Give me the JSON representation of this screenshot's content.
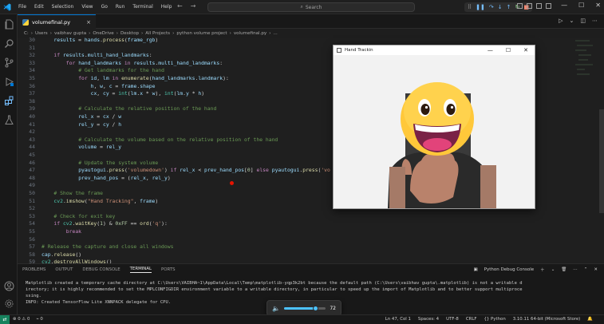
{
  "titlebar": {
    "menu": [
      "File",
      "Edit",
      "Selection",
      "View",
      "Go",
      "Run",
      "Terminal",
      "Help"
    ],
    "search_label": "Search"
  },
  "tab": {
    "filename": "volumefinal.py",
    "close_glyph": "×"
  },
  "breadcrumb": [
    "C:",
    "Users",
    "vaibhav gupta",
    "OneDrive",
    "Desktop",
    "All Projects",
    "python volume project",
    "volumefinal.py",
    "..."
  ],
  "code_lines": [
    {
      "n": "30",
      "indent": 2,
      "segs": [
        [
          "var",
          "results"
        ],
        [
          "op",
          " = "
        ],
        [
          "var",
          "hands"
        ],
        [
          "op",
          "."
        ],
        [
          "fn",
          "process"
        ],
        [
          "op",
          "("
        ],
        [
          "var",
          "frame_rgb"
        ],
        [
          "op",
          ")"
        ]
      ]
    },
    {
      "n": "31",
      "indent": 0,
      "segs": []
    },
    {
      "n": "32",
      "indent": 2,
      "segs": [
        [
          "kw",
          "if "
        ],
        [
          "var",
          "results"
        ],
        [
          "op",
          "."
        ],
        [
          "var",
          "multi_hand_landmarks"
        ],
        [
          "op",
          ":"
        ]
      ]
    },
    {
      "n": "33",
      "indent": 4,
      "segs": [
        [
          "kw",
          "for "
        ],
        [
          "var",
          "hand_landmarks"
        ],
        [
          "kw",
          " in "
        ],
        [
          "var",
          "results"
        ],
        [
          "op",
          "."
        ],
        [
          "var",
          "multi_hand_landmarks"
        ],
        [
          "op",
          ":"
        ]
      ]
    },
    {
      "n": "34",
      "indent": 6,
      "segs": [
        [
          "cm",
          "# Get landmarks for the hand"
        ]
      ]
    },
    {
      "n": "35",
      "indent": 6,
      "segs": [
        [
          "kw",
          "for "
        ],
        [
          "var",
          "id"
        ],
        [
          "op",
          ", "
        ],
        [
          "var",
          "lm"
        ],
        [
          "kw",
          " in "
        ],
        [
          "fn",
          "enumerate"
        ],
        [
          "op",
          "("
        ],
        [
          "var",
          "hand_landmarks"
        ],
        [
          "op",
          "."
        ],
        [
          "var",
          "landmark"
        ],
        [
          "op",
          "):"
        ]
      ]
    },
    {
      "n": "36",
      "indent": 8,
      "segs": [
        [
          "var",
          "h"
        ],
        [
          "op",
          ", "
        ],
        [
          "var",
          "w"
        ],
        [
          "op",
          ", "
        ],
        [
          "var",
          "c"
        ],
        [
          "op",
          " = "
        ],
        [
          "var",
          "frame"
        ],
        [
          "op",
          "."
        ],
        [
          "var",
          "shape"
        ]
      ]
    },
    {
      "n": "37",
      "indent": 8,
      "segs": [
        [
          "var",
          "cx"
        ],
        [
          "op",
          ", "
        ],
        [
          "var",
          "cy"
        ],
        [
          "op",
          " = "
        ],
        [
          "bi",
          "int"
        ],
        [
          "op",
          "("
        ],
        [
          "var",
          "lm"
        ],
        [
          "op",
          "."
        ],
        [
          "var",
          "x"
        ],
        [
          "op",
          " * "
        ],
        [
          "var",
          "w"
        ],
        [
          "op",
          "), "
        ],
        [
          "bi",
          "int"
        ],
        [
          "op",
          "("
        ],
        [
          "var",
          "lm"
        ],
        [
          "op",
          "."
        ],
        [
          "var",
          "y"
        ],
        [
          "op",
          " * "
        ],
        [
          "var",
          "h"
        ],
        [
          "op",
          ")"
        ]
      ]
    },
    {
      "n": "38",
      "indent": 0,
      "segs": []
    },
    {
      "n": "39",
      "indent": 6,
      "segs": [
        [
          "cm",
          "# Calculate the relative position of the hand"
        ]
      ]
    },
    {
      "n": "40",
      "indent": 6,
      "segs": [
        [
          "var",
          "rel_x"
        ],
        [
          "op",
          " = "
        ],
        [
          "var",
          "cx"
        ],
        [
          "op",
          " / "
        ],
        [
          "var",
          "w"
        ]
      ]
    },
    {
      "n": "41",
      "indent": 6,
      "segs": [
        [
          "var",
          "rel_y"
        ],
        [
          "op",
          " = "
        ],
        [
          "var",
          "cy"
        ],
        [
          "op",
          " / "
        ],
        [
          "var",
          "h"
        ]
      ]
    },
    {
      "n": "42",
      "indent": 0,
      "segs": []
    },
    {
      "n": "43",
      "indent": 6,
      "segs": [
        [
          "cm",
          "# Calculate the volume based on the relative position of the hand"
        ]
      ]
    },
    {
      "n": "44",
      "indent": 6,
      "segs": [
        [
          "var",
          "volume"
        ],
        [
          "op",
          " = "
        ],
        [
          "var",
          "rel_y"
        ]
      ]
    },
    {
      "n": "45",
      "indent": 0,
      "segs": []
    },
    {
      "n": "46",
      "indent": 6,
      "segs": [
        [
          "cm",
          "# Update the system volume"
        ]
      ]
    },
    {
      "n": "47",
      "indent": 6,
      "segs": [
        [
          "var",
          "pyautogui"
        ],
        [
          "op",
          "."
        ],
        [
          "fn",
          "press"
        ],
        [
          "op",
          "("
        ],
        [
          "str",
          "'volumedown'"
        ],
        [
          "op",
          ") "
        ],
        [
          "kw",
          "if "
        ],
        [
          "var",
          "rel_x"
        ],
        [
          "op",
          " < "
        ],
        [
          "var",
          "prev_hand_pos"
        ],
        [
          "op",
          "["
        ],
        [
          "num",
          "0"
        ],
        [
          "op",
          "] "
        ],
        [
          "kw",
          "else "
        ],
        [
          "var",
          "pyautogui"
        ],
        [
          "op",
          "."
        ],
        [
          "fn",
          "press"
        ],
        [
          "op",
          "("
        ],
        [
          "str",
          "'vo"
        ]
      ]
    },
    {
      "n": "48",
      "indent": 6,
      "segs": [
        [
          "var",
          "prev_hand_pos"
        ],
        [
          "op",
          " = ("
        ],
        [
          "var",
          "rel_x"
        ],
        [
          "op",
          ", "
        ],
        [
          "var",
          "rel_y"
        ],
        [
          "op",
          ")"
        ]
      ]
    },
    {
      "n": "49",
      "indent": 0,
      "segs": []
    },
    {
      "n": "50",
      "indent": 2,
      "segs": [
        [
          "cm",
          "# Show the frame"
        ]
      ]
    },
    {
      "n": "51",
      "indent": 2,
      "segs": [
        [
          "bi",
          "cv2"
        ],
        [
          "op",
          "."
        ],
        [
          "fn",
          "imshow"
        ],
        [
          "op",
          "("
        ],
        [
          "str",
          "\"Hand Tracking\""
        ],
        [
          "op",
          ", "
        ],
        [
          "var",
          "frame"
        ],
        [
          "op",
          ")"
        ]
      ]
    },
    {
      "n": "52",
      "indent": 0,
      "segs": []
    },
    {
      "n": "53",
      "indent": 2,
      "segs": [
        [
          "cm",
          "# Check for exit key"
        ]
      ]
    },
    {
      "n": "54",
      "indent": 2,
      "segs": [
        [
          "kw",
          "if "
        ],
        [
          "bi",
          "cv2"
        ],
        [
          "op",
          "."
        ],
        [
          "fn",
          "waitKey"
        ],
        [
          "op",
          "("
        ],
        [
          "num",
          "1"
        ],
        [
          "op",
          ") & "
        ],
        [
          "num",
          "0xFF"
        ],
        [
          "op",
          " == "
        ],
        [
          "fn",
          "ord"
        ],
        [
          "op",
          "("
        ],
        [
          "str",
          "'q'"
        ],
        [
          "op",
          "):"
        ]
      ]
    },
    {
      "n": "55",
      "indent": 4,
      "segs": [
        [
          "kw",
          "break"
        ]
      ]
    },
    {
      "n": "56",
      "indent": 0,
      "segs": []
    },
    {
      "n": "57",
      "indent": 0,
      "segs": [
        [
          "cm",
          "# Release the capture and close all windows"
        ]
      ]
    },
    {
      "n": "58",
      "indent": 0,
      "segs": [
        [
          "var",
          "cap"
        ],
        [
          "op",
          "."
        ],
        [
          "fn",
          "release"
        ],
        [
          "op",
          "()"
        ]
      ]
    },
    {
      "n": "59",
      "indent": 0,
      "segs": [
        [
          "bi",
          "cv2"
        ],
        [
          "op",
          "."
        ],
        [
          "fn",
          "destroyAllWindows"
        ],
        [
          "op",
          "()"
        ]
      ]
    }
  ],
  "hand_window": {
    "title": "Hand Trackin"
  },
  "panel": {
    "tabs": [
      "PROBLEMS",
      "OUTPUT",
      "DEBUG CONSOLE",
      "TERMINAL",
      "PORTS"
    ],
    "active_tab": "TERMINAL",
    "terminal_profile": "Python Debug Console",
    "terminal_lines": [
      "Matplotlib created a temporary cache directory at C:\\Users\\VAIBHA~1\\AppData\\Local\\Temp\\matplotlib-yqp3k2bt because the default path (C:\\Users\\vaibhav gupta\\.matplotlib) is not a writable d",
      "irectory; it is highly recommended to set the MPLCONFIGDIR environment variable to a writable directory, in particular to speed up the import of Matplotlib and to better support multiproce",
      "ssing.",
      "INFO: Created TensorFlow Lite XNNPACK delegate for CPU."
    ]
  },
  "volume": {
    "value": "72",
    "level": 0.72
  },
  "statusbar": {
    "errors": "0",
    "warnings": "0",
    "ports": "0",
    "position": "Ln 47, Col 1",
    "spaces": "Spaces: 4",
    "encoding": "UTF-8",
    "eol": "CRLF",
    "language": "Python",
    "interpreter": "3.10.11 64-bit (Microsoft Store)"
  },
  "colors": {
    "accent": "#0078d4",
    "remote": "#16825d",
    "volume": "#4cc2ff",
    "breakpoint": "#e51400"
  }
}
